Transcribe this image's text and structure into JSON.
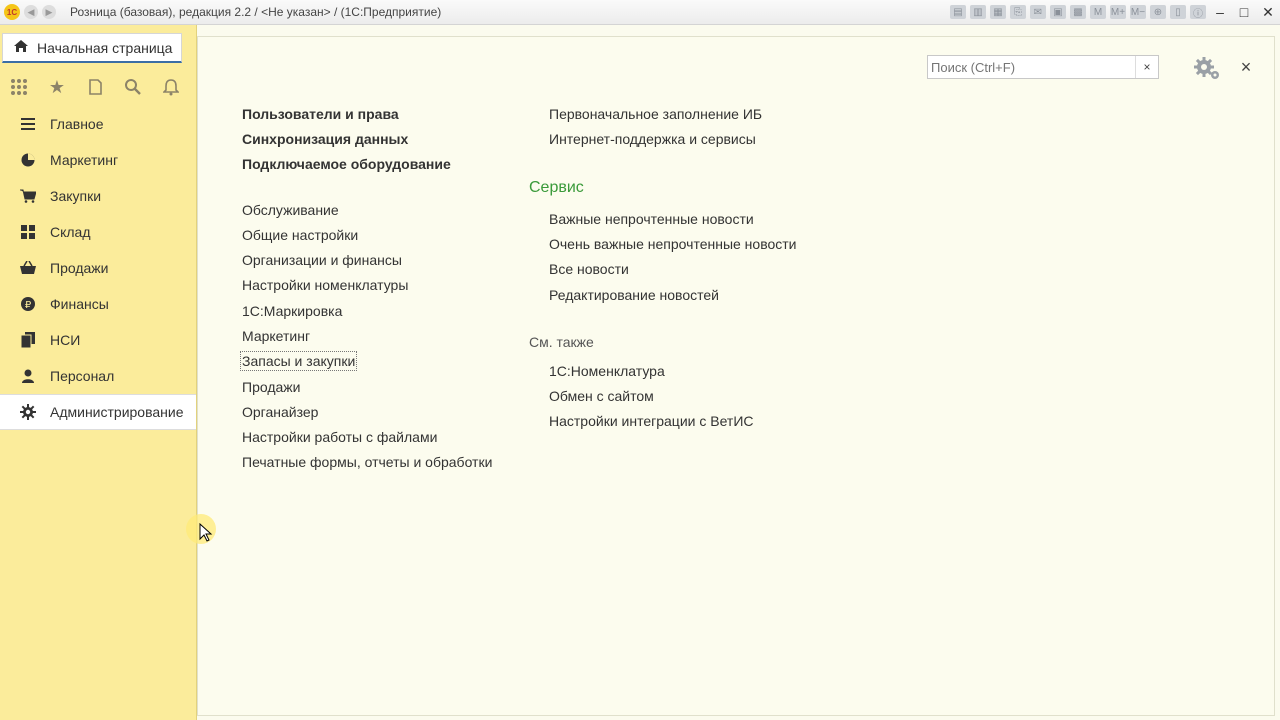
{
  "titlebar": {
    "logo": "1С",
    "title": "Розница (базовая), редакция 2.2 / <Не указан> / (1С:Предприятие)",
    "tools": [
      "M",
      "M+",
      "M−"
    ]
  },
  "sidebar": {
    "home_label": "Начальная страница",
    "quick_icons": [
      "apps-grid-icon",
      "star-icon",
      "history-icon",
      "search-icon",
      "bell-icon"
    ],
    "sections": [
      {
        "label": "Главное",
        "icon": "menu-lines-icon"
      },
      {
        "label": "Маркетинг",
        "icon": "pie-chart-icon"
      },
      {
        "label": "Закупки",
        "icon": "cart-icon"
      },
      {
        "label": "Склад",
        "icon": "warehouse-grid-icon"
      },
      {
        "label": "Продажи",
        "icon": "basket-icon"
      },
      {
        "label": "Финансы",
        "icon": "ruble-coin-icon"
      },
      {
        "label": "НСИ",
        "icon": "documents-icon"
      },
      {
        "label": "Персонал",
        "icon": "person-icon"
      },
      {
        "label": "Администрирование",
        "icon": "gear-icon",
        "active": true
      }
    ]
  },
  "search": {
    "placeholder": "Поиск (Ctrl+F)",
    "clear": "×"
  },
  "close_label": "×",
  "col1": {
    "bold": [
      "Пользователи и права",
      "Синхронизация данных",
      "Подключаемое оборудование"
    ],
    "links": [
      "Обслуживание",
      "Общие настройки",
      "Организации и финансы",
      "Настройки номенклатуры",
      "1С:Маркировка",
      "Маркетинг",
      "Запасы и закупки",
      "Продажи",
      "Органайзер",
      "Настройки работы с файлами",
      "Печатные формы, отчеты и обработки"
    ]
  },
  "col2": {
    "top": [
      "Первоначальное заполнение ИБ",
      "Интернет-поддержка и сервисы"
    ],
    "service_head": "Сервис",
    "service": [
      "Важные непрочтенные новости",
      "Очень важные непрочтенные новости",
      "Все новости",
      "Редактирование новостей"
    ],
    "also_head": "См. также",
    "also": [
      "1С:Номенклатура",
      "Обмен с сайтом",
      "Настройки интеграции с ВетИС"
    ]
  },
  "colors": {
    "sidebar": "#fbec9b",
    "content": "#fcfcee",
    "group_head": "#3a9a3a"
  }
}
